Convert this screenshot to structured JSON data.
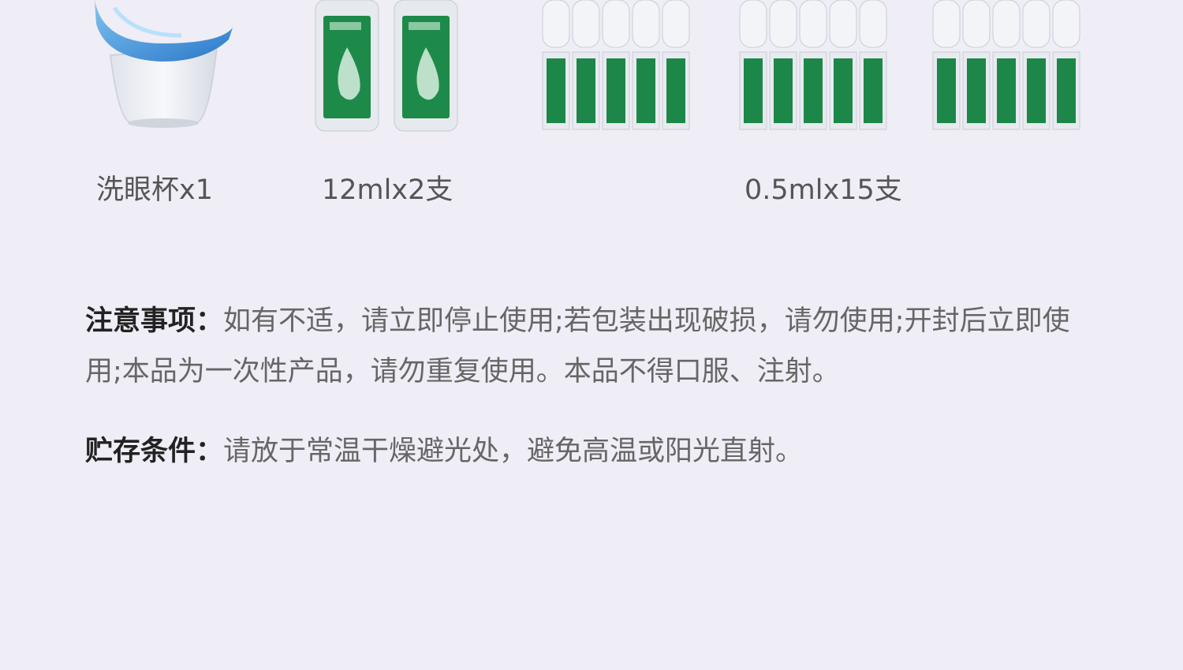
{
  "captions": {
    "cup": "洗眼杯x1",
    "bottles": "12mlx2支",
    "vials": "0.5mlx15支"
  },
  "notes": {
    "precautions_label": "注意事项：",
    "precautions_text": "如有不适，请立即停止使用;若包装出现破损，请勿使用;开封后立即使用;本品为一次性产品，请勿重复使用。本品不得口服、注射。",
    "storage_label": "贮存条件：",
    "storage_text": "请放于常温干燥避光处，避免高温或阳光直射。"
  },
  "colors": {
    "background": "#efedf5",
    "label_green": "#1f8a4c",
    "cup_blue": "#2f8fd8"
  },
  "icons": {
    "cup": "eye-wash-cup-image",
    "bottle": "eye-drop-bottle-image",
    "vial": "single-dose-vial-image"
  }
}
